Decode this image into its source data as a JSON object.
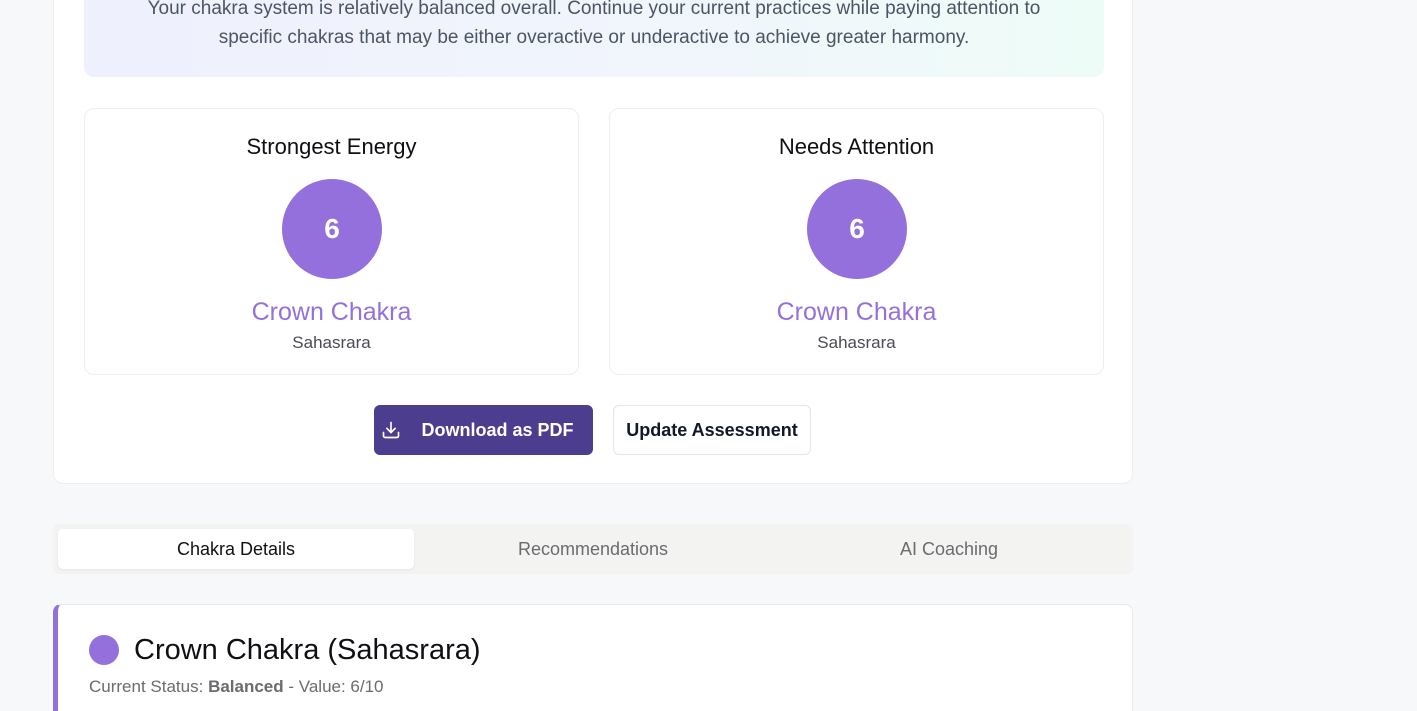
{
  "insight": {
    "text": "Your chakra system is relatively balanced overall. Continue your current practices while paying attention to specific chakras that may be either overactive or underactive to achieve greater harmony."
  },
  "strongest": {
    "title": "Strongest Energy",
    "number": "6",
    "name": "Crown Chakra",
    "sanskrit": "Sahasrara"
  },
  "attention": {
    "title": "Needs Attention",
    "number": "6",
    "name": "Crown Chakra",
    "sanskrit": "Sahasrara"
  },
  "actions": {
    "download_label": "Download as PDF",
    "download_icon": "download-icon",
    "update_label": "Update Assessment"
  },
  "tabs": [
    {
      "label": "Chakra Details",
      "active": true
    },
    {
      "label": "Recommendations",
      "active": false
    },
    {
      "label": "AI Coaching",
      "active": false
    }
  ],
  "detail": {
    "title": "Crown Chakra (Sahasrara)",
    "status_prefix": "Current Status: ",
    "status_value": "Balanced",
    "value_text": " - Value: 6/10"
  },
  "colors": {
    "accent": "#9370db",
    "primary_button": "#4c3d8f"
  }
}
